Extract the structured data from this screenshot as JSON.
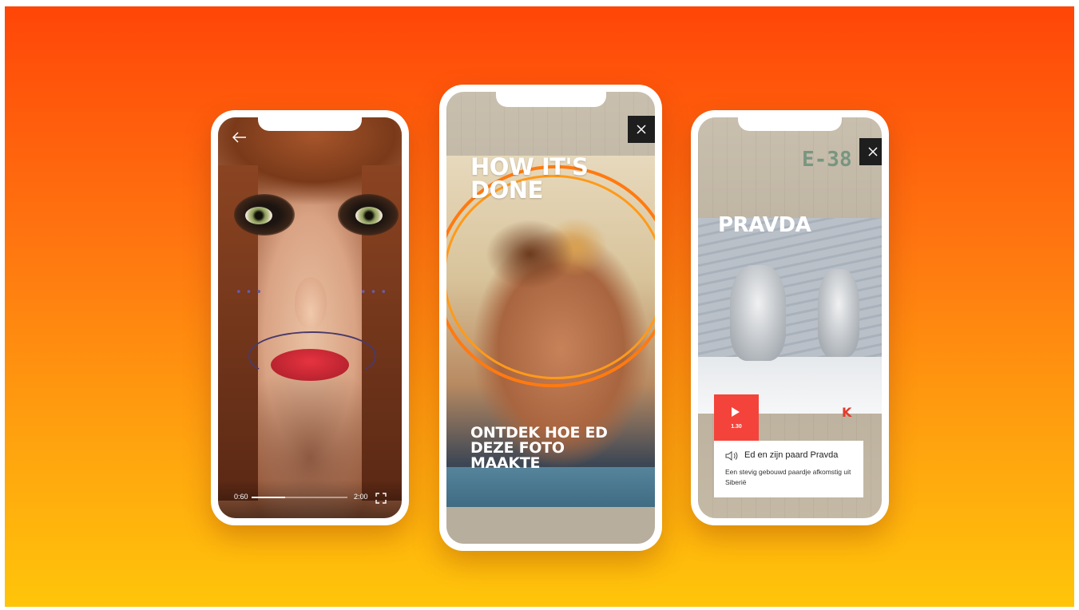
{
  "colors": {
    "background_top": "#ff4608",
    "background_bottom": "#ffc50a",
    "accent_red": "#f4433a",
    "ring_orange": "#ff7a10",
    "close_button": "#1e1e1e"
  },
  "phone_1": {
    "back_icon": "arrow-left-icon",
    "video": {
      "elapsed": "0:60",
      "total": "2:00",
      "progress_fraction": 0.35,
      "fullscreen_icon": "fullscreen-icon"
    }
  },
  "phone_2": {
    "close_icon": "close-icon",
    "title": "HOW IT'S DONE",
    "cta": "ONTDEK HOE ED DEZE FOTO MAAKTE"
  },
  "phone_3": {
    "close_icon": "close-icon",
    "stamp": "E-38",
    "title": "PRAVDA",
    "marker": "K",
    "play": {
      "icon": "play-icon",
      "duration": "1.30"
    },
    "audio": {
      "icon": "speaker-icon",
      "title": "Ed en zijn paard Pravda",
      "description": "Een stevig gebouwd paardje afkomstig uit Siberië"
    }
  }
}
